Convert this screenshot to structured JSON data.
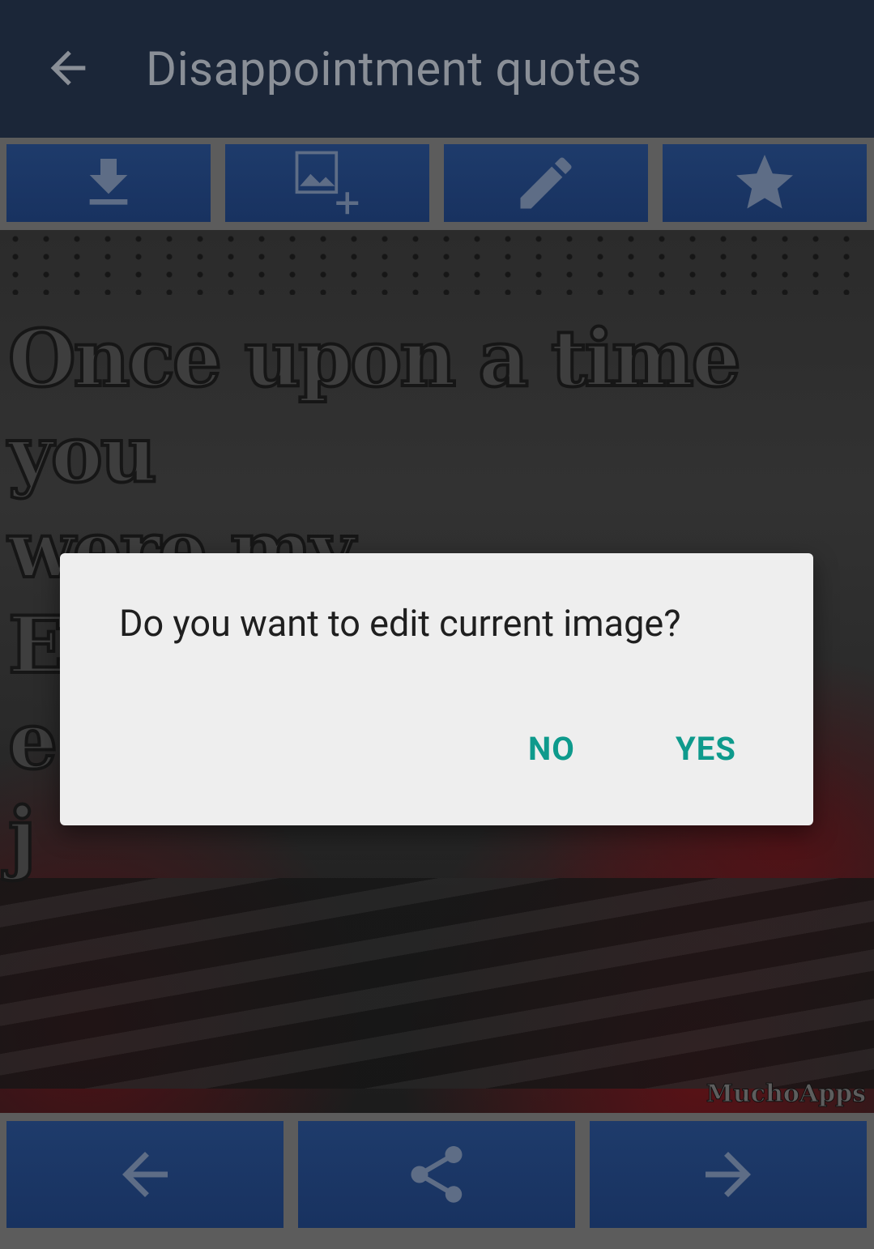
{
  "app_bar": {
    "title": "Disappointment quotes",
    "back_icon": "arrow-back-icon"
  },
  "toolbar": {
    "buttons": [
      {
        "name": "download",
        "icon": "download-icon"
      },
      {
        "name": "add-image",
        "icon": "add-image-icon"
      },
      {
        "name": "edit",
        "icon": "pencil-icon"
      },
      {
        "name": "favorite",
        "icon": "star-icon"
      }
    ]
  },
  "image": {
    "quote_lines": [
      "Once upon a time you",
      "were my EVERYTHING,",
      "e",
      "j"
    ],
    "watermark": "MuchoApps"
  },
  "dialog": {
    "message": "Do you want to edit current image?",
    "no_label": "NO",
    "yes_label": "YES"
  },
  "bottom_nav": {
    "buttons": [
      {
        "name": "previous",
        "icon": "arrow-left-icon"
      },
      {
        "name": "share",
        "icon": "share-icon"
      },
      {
        "name": "next",
        "icon": "arrow-right-icon"
      }
    ]
  },
  "colors": {
    "appbar": "#1b2638",
    "button": "#1e3b6b",
    "dialog_bg": "#eeeeee",
    "accent": "#0e9a8c"
  }
}
